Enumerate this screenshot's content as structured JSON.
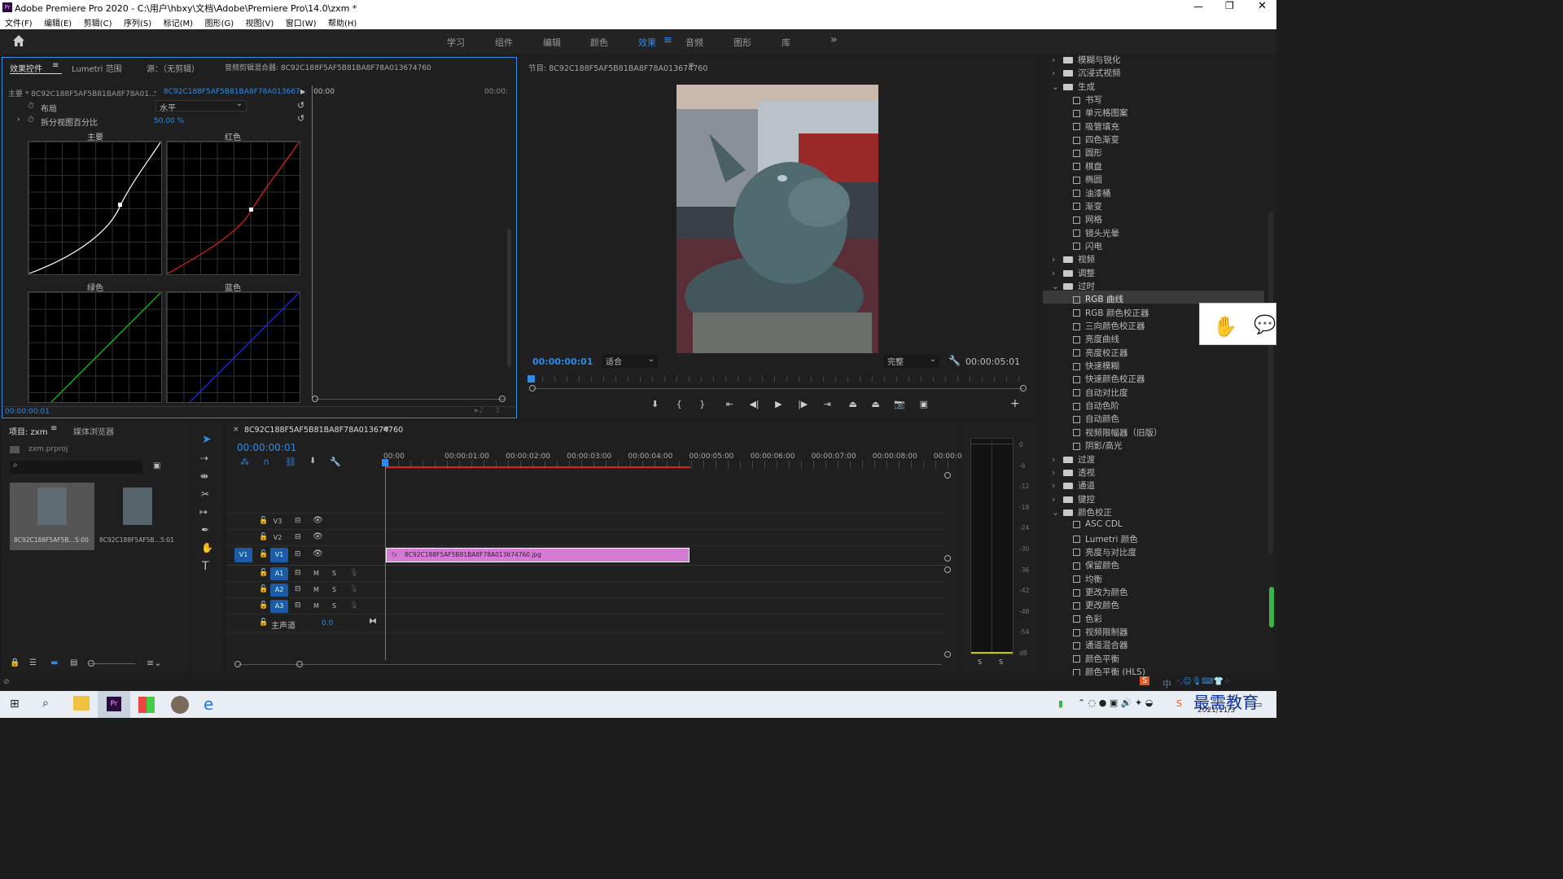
{
  "window": {
    "title": "Adobe Premiere Pro 2020 - C:\\用户\\hbxy\\文档\\Adobe\\Premiere Pro\\14.0\\zxm *",
    "app_icon": "Pr"
  },
  "menu": [
    "文件(F)",
    "编辑(E)",
    "剪辑(C)",
    "序列(S)",
    "标记(M)",
    "图形(G)",
    "视图(V)",
    "窗口(W)",
    "帮助(H)"
  ],
  "workspaces": [
    "学习",
    "组件",
    "编辑",
    "颜色",
    "效果",
    "音频",
    "图形",
    "库"
  ],
  "active_workspace": "效果",
  "effect_controls": {
    "tabs": [
      "效果控件",
      "Lumetri 范围",
      "源：（无剪辑）",
      "音频剪辑混合器: 8C92C188F5AF5B81BA8F78A013674760"
    ],
    "master": "主要 * 8C92C188F5AF5B81BA8F78A01...",
    "clip": "8C92C188F5AF5B81BA8F78A013667...",
    "layout_label": "布局",
    "layout_value": "水平",
    "split_label": "拆分视图百分比",
    "split_value": "50.00 %",
    "curves": [
      "主要",
      "红色",
      "绿色",
      "蓝色"
    ],
    "time_start": "00:00",
    "time_end": "00:00:",
    "timecode": "00:00:00:01"
  },
  "program": {
    "title": "节目: 8C92C188F5AF5B81BA8F78A013674760",
    "timecode": "00:00:00:01",
    "fit": "适合",
    "quality": "完整",
    "duration": "00:00:05:01"
  },
  "project": {
    "tabs": [
      "项目: zxm",
      "媒体浏览器"
    ],
    "file": "zxm.prproj",
    "items": [
      {
        "name": "8C92C188F5AF5B...",
        "dur": "5:00"
      },
      {
        "name": "8C92C188F5AF5B...",
        "dur": "5:01"
      }
    ]
  },
  "timeline": {
    "tab": "8C92C188F5AF5B81BA8F78A013674760",
    "timecode": "00:00:00:01",
    "ruler": [
      "00:00",
      "00:00:01:00",
      "00:00:02:00",
      "00:00:03:00",
      "00:00:04:00",
      "00:00:05:00",
      "00:00:06:00",
      "00:00:07:00",
      "00:00:08:00",
      "00:00:09:"
    ],
    "video_tracks": [
      "V3",
      "V2",
      "V1"
    ],
    "audio_tracks": [
      "A1",
      "A2",
      "A3"
    ],
    "master": "主声道",
    "master_value": "0.0",
    "clip": "8C92C188F5AF5B81BA8F78A013674760.jpg",
    "src_patch": "V1",
    "m": "M",
    "s": "S"
  },
  "meter": {
    "labels": [
      "0",
      "-6",
      "-12",
      "-18",
      "-24",
      "-30",
      "-36",
      "-42",
      "-48",
      "-54",
      "dB"
    ],
    "s": "S"
  },
  "effects_tree": [
    {
      "label": "模糊与锐化",
      "kind": "folder",
      "open": false
    },
    {
      "label": "沉浸式视频",
      "kind": "folder",
      "open": false
    },
    {
      "label": "生成",
      "kind": "folder",
      "open": true
    },
    {
      "label": "书写",
      "kind": "item"
    },
    {
      "label": "单元格图案",
      "kind": "item"
    },
    {
      "label": "吸管填充",
      "kind": "item"
    },
    {
      "label": "四色渐变",
      "kind": "item"
    },
    {
      "label": "圆形",
      "kind": "item"
    },
    {
      "label": "棋盘",
      "kind": "item"
    },
    {
      "label": "椭圆",
      "kind": "item"
    },
    {
      "label": "油漆桶",
      "kind": "item"
    },
    {
      "label": "渐变",
      "kind": "item"
    },
    {
      "label": "网格",
      "kind": "item"
    },
    {
      "label": "镜头光晕",
      "kind": "item"
    },
    {
      "label": "闪电",
      "kind": "item"
    },
    {
      "label": "视频",
      "kind": "folder",
      "open": false
    },
    {
      "label": "调整",
      "kind": "folder",
      "open": false
    },
    {
      "label": "过时",
      "kind": "folder",
      "open": true
    },
    {
      "label": "RGB 曲线",
      "kind": "item",
      "selected": true
    },
    {
      "label": "RGB 颜色校正器",
      "kind": "item"
    },
    {
      "label": "三向颜色校正器",
      "kind": "item"
    },
    {
      "label": "亮度曲线",
      "kind": "item"
    },
    {
      "label": "亮度校正器",
      "kind": "item"
    },
    {
      "label": "快速模糊",
      "kind": "item"
    },
    {
      "label": "快速颜色校正器",
      "kind": "item"
    },
    {
      "label": "自动对比度",
      "kind": "item"
    },
    {
      "label": "自动色阶",
      "kind": "item"
    },
    {
      "label": "自动颜色",
      "kind": "item"
    },
    {
      "label": "视频限幅器（旧版）",
      "kind": "item"
    },
    {
      "label": "阴影/高光",
      "kind": "item"
    },
    {
      "label": "过渡",
      "kind": "folder",
      "open": false
    },
    {
      "label": "透视",
      "kind": "folder",
      "open": false
    },
    {
      "label": "通道",
      "kind": "folder",
      "open": false
    },
    {
      "label": "键控",
      "kind": "folder",
      "open": false
    },
    {
      "label": "颜色校正",
      "kind": "folder",
      "open": true
    },
    {
      "label": "ASC CDL",
      "kind": "item"
    },
    {
      "label": "Lumetri 颜色",
      "kind": "item"
    },
    {
      "label": "亮度与对比度",
      "kind": "item"
    },
    {
      "label": "保留颜色",
      "kind": "item"
    },
    {
      "label": "均衡",
      "kind": "item"
    },
    {
      "label": "更改为颜色",
      "kind": "item"
    },
    {
      "label": "更改颜色",
      "kind": "item"
    },
    {
      "label": "色彩",
      "kind": "item"
    },
    {
      "label": "视频限制器",
      "kind": "item"
    },
    {
      "label": "通道混合器",
      "kind": "item"
    },
    {
      "label": "颜色平衡",
      "kind": "item"
    },
    {
      "label": "颜色平衡 (HLS)",
      "kind": "item"
    }
  ],
  "taskbar": {
    "date": "2021/11/3",
    "watermark": "最需教育",
    "ime": "中"
  },
  "colors": {
    "accent": "#2d8ceb",
    "clip": "#d57ad5",
    "bg": "#1d1d1d"
  }
}
